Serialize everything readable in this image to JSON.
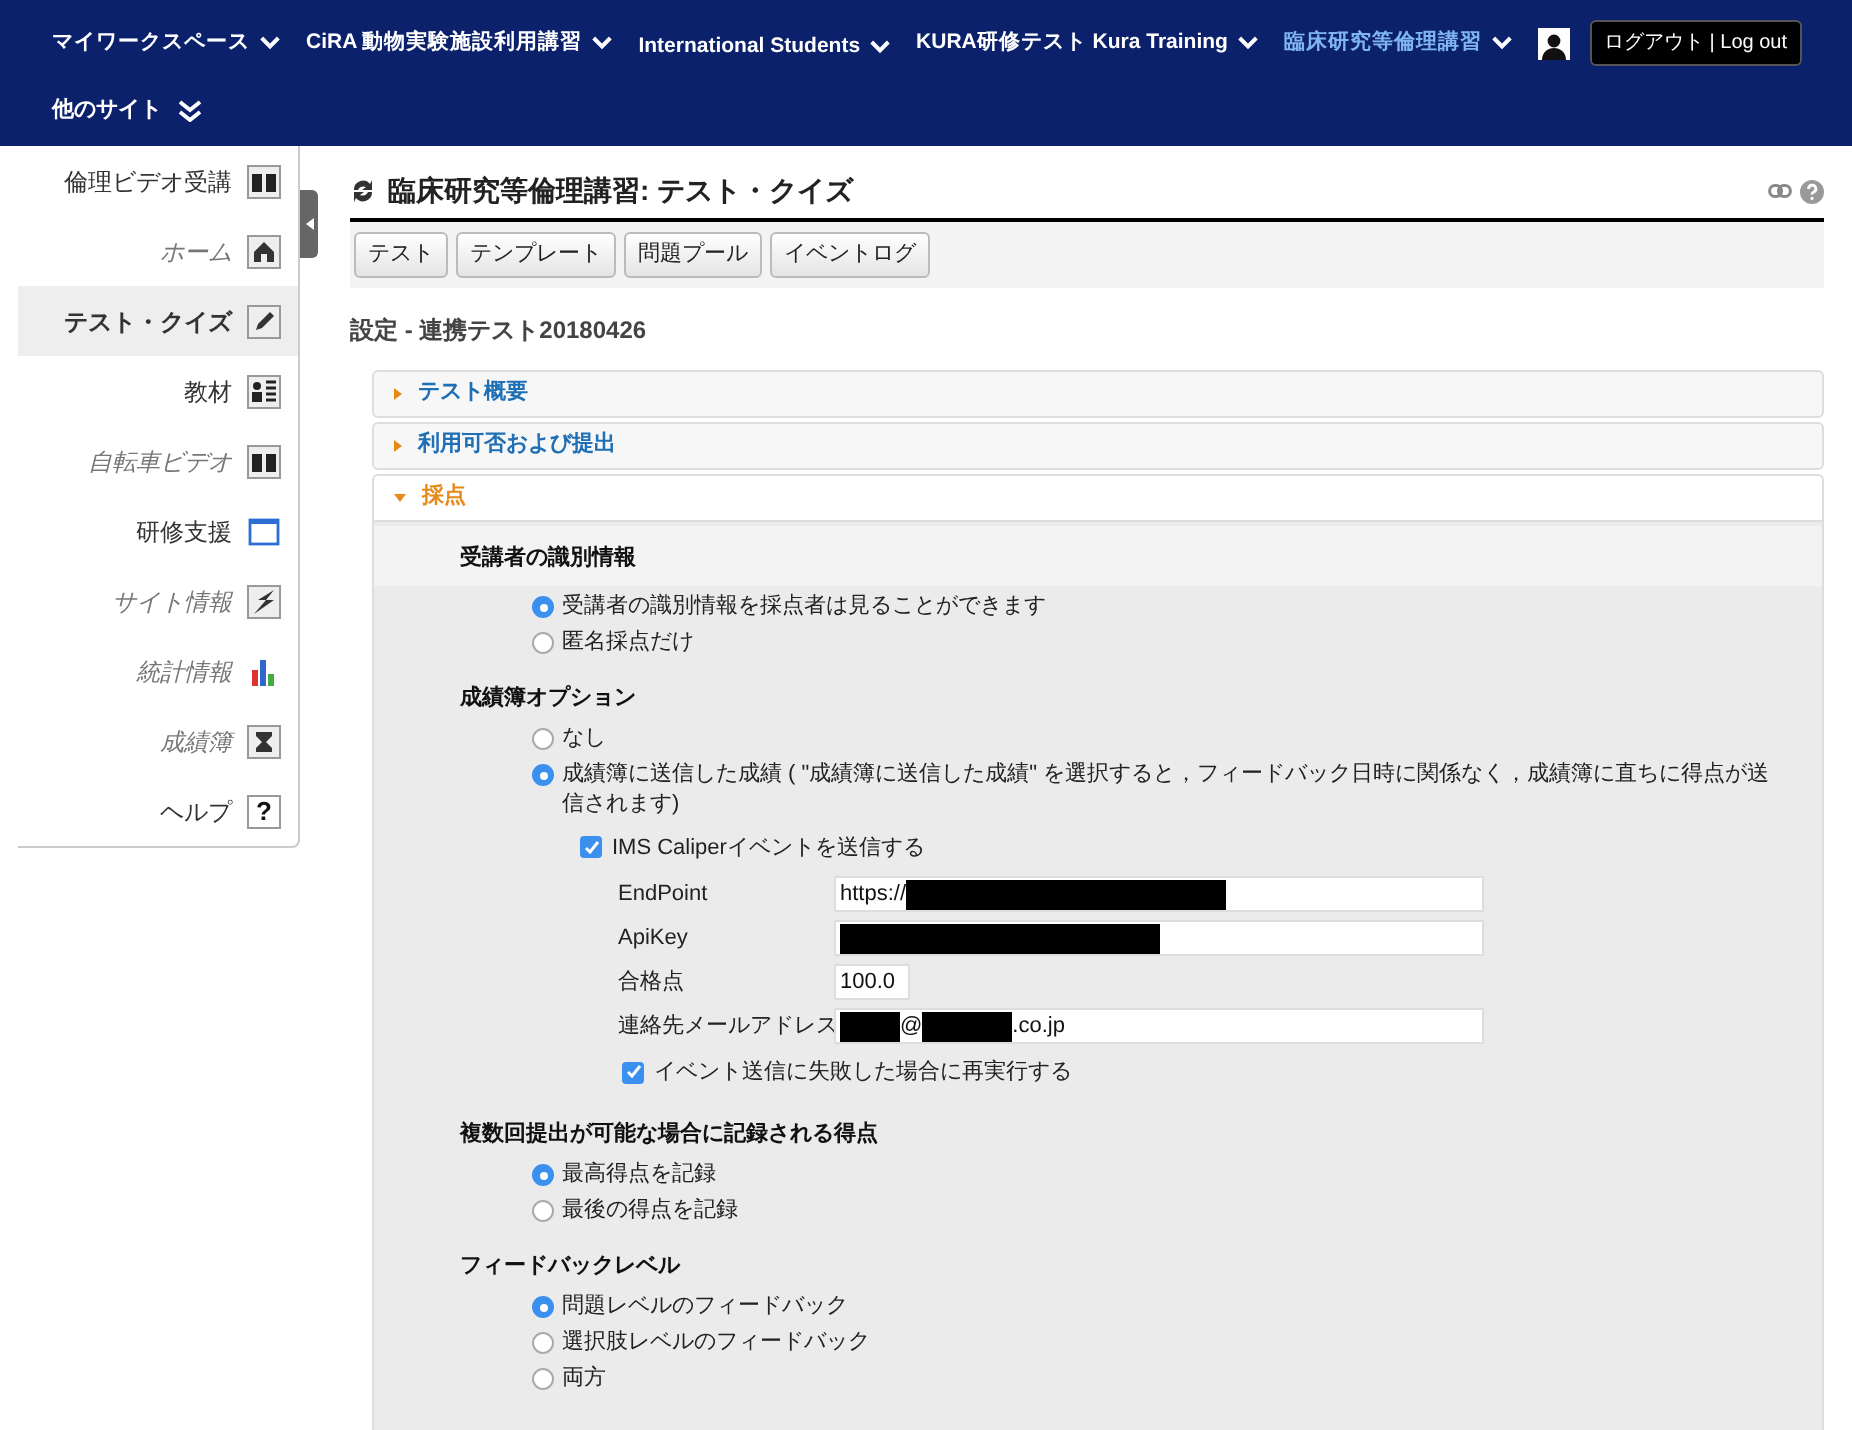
{
  "top_nav": {
    "sites": [
      {
        "label": "マイワークスペース",
        "selected": false
      },
      {
        "label": "CiRA 動物実験施設利用講習",
        "selected": false
      },
      {
        "label": "International Students",
        "selected": false
      },
      {
        "label": "KURA研修テスト Kura Training",
        "selected": false
      },
      {
        "label": "臨床研究等倫理講習",
        "selected": true
      }
    ],
    "logout": "ログアウト | Log out",
    "more_sites": "他のサイト"
  },
  "sidebar": {
    "items": [
      {
        "label": "倫理ビデオ受講",
        "selected": false,
        "hidden": false
      },
      {
        "label": "ホーム",
        "selected": false,
        "hidden": true
      },
      {
        "label": "テスト・クイズ",
        "selected": true,
        "hidden": false
      },
      {
        "label": "教材",
        "selected": false,
        "hidden": false
      },
      {
        "label": "自転車ビデオ",
        "selected": false,
        "hidden": true
      },
      {
        "label": "研修支援",
        "selected": false,
        "hidden": false
      },
      {
        "label": "サイト情報",
        "selected": false,
        "hidden": true
      },
      {
        "label": "統計情報",
        "selected": false,
        "hidden": true
      },
      {
        "label": "成績簿",
        "selected": false,
        "hidden": true
      },
      {
        "label": "ヘルプ",
        "selected": false,
        "hidden": false,
        "icon_text": "?"
      }
    ]
  },
  "tool_title": "臨床研究等倫理講習: テスト・クイズ",
  "toolbar": [
    "テスト",
    "テンプレート",
    "問題プール",
    "イベントログ"
  ],
  "subtitle": "設定 - 連携テスト20180426",
  "sections": [
    {
      "title": "テスト概要",
      "expanded": false
    },
    {
      "title": "利用可否および提出",
      "expanded": false
    },
    {
      "title": "採点",
      "expanded": true
    }
  ],
  "grading": [
    {
      "kind": "heading",
      "text": "受講者の識別情報",
      "banded": true
    },
    {
      "kind": "radio",
      "text": "受講者の識別情報を採点者は見ることができます",
      "selected": true
    },
    {
      "kind": "radio",
      "text": "匿名採点だけ",
      "selected": false
    },
    {
      "kind": "heading",
      "text": "成績簿オプション",
      "banded": false
    },
    {
      "kind": "radio",
      "text": "なし",
      "selected": false
    },
    {
      "kind": "radio",
      "text": "成績簿に送信した成績 ( \"成績簿に送信した成績\" を選択すると，フィードバック日時に関係なく，成績簿に直ちに得点が送信されます)",
      "selected": true
    },
    {
      "kind": "checkbox",
      "text": "IMS Caliperイベントを送信する",
      "checked": true
    },
    {
      "kind": "field",
      "label": "EndPoint",
      "value": [
        {
          "kind": "text",
          "text": "https://"
        },
        {
          "kind": "redacted_long"
        }
      ]
    },
    {
      "kind": "field",
      "label": "ApiKey",
      "value": [
        {
          "kind": "redacted_long"
        }
      ]
    },
    {
      "kind": "short_field",
      "label": "合格点",
      "value": [
        {
          "kind": "text",
          "text": "100.0"
        }
      ]
    },
    {
      "kind": "field",
      "label": "連絡先メールアドレス",
      "value": [
        {
          "kind": "redacted_short"
        },
        {
          "kind": "text",
          "text": "@"
        },
        {
          "kind": "redacted_medium"
        },
        {
          "kind": "text",
          "text": ".co.jp"
        }
      ]
    },
    {
      "kind": "subcheckbox",
      "text": "イベント送信に失敗した場合に再実行する",
      "checked": true
    },
    {
      "kind": "heading",
      "text": "複数回提出が可能な場合に記録される得点",
      "banded": false
    },
    {
      "kind": "radio",
      "text": "最高得点を記録",
      "selected": true
    },
    {
      "kind": "radio",
      "text": "最後の得点を記録",
      "selected": false
    },
    {
      "kind": "heading",
      "text": "フィードバックレベル",
      "banded": false
    },
    {
      "kind": "radio",
      "text": "問題レベルのフィードバック",
      "selected": true
    },
    {
      "kind": "radio",
      "text": "選択肢レベルのフィードバック",
      "selected": false
    },
    {
      "kind": "radio",
      "text": "両方",
      "selected": false
    }
  ]
}
